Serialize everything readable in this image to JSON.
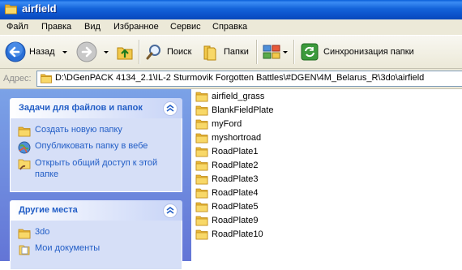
{
  "window": {
    "title": "airfield"
  },
  "menu": [
    "Файл",
    "Правка",
    "Вид",
    "Избранное",
    "Сервис",
    "Справка"
  ],
  "toolbar": {
    "back_label": "Назад",
    "search_label": "Поиск",
    "folders_label": "Папки",
    "sync_label": "Синхронизация папки"
  },
  "address": {
    "label": "Адрес:",
    "path": "D:\\DGenPACK 4134_2.1\\IL-2 Sturmovik Forgotten Battles\\#DGEN\\4M_Belarus_R\\3do\\airfield"
  },
  "tasks_panel": {
    "title": "Задачи для файлов и папок",
    "items": [
      {
        "label": "Создать новую папку",
        "icon": "new-folder-icon"
      },
      {
        "label": "Опубликовать папку в вебе",
        "icon": "publish-web-icon"
      },
      {
        "label": "Открыть общий доступ к этой папке",
        "icon": "share-folder-icon"
      }
    ]
  },
  "places_panel": {
    "title": "Другие места",
    "items": [
      {
        "label": "3do",
        "icon": "folder-icon"
      },
      {
        "label": "Мои документы",
        "icon": "my-documents-icon"
      }
    ]
  },
  "files": [
    "airfield_grass",
    "BlankFieldPlate",
    "myFord",
    "myshortroad",
    "RoadPlate1",
    "RoadPlate2",
    "RoadPlate3",
    "RoadPlate4",
    "RoadPlate5",
    "RoadPlate9",
    "RoadPlate10"
  ],
  "colors": {
    "title_blue": "#0b50c9",
    "panel_link": "#215dc6",
    "panel_bg": "#d6dff7",
    "folder_yellow": "#f5d04c"
  }
}
